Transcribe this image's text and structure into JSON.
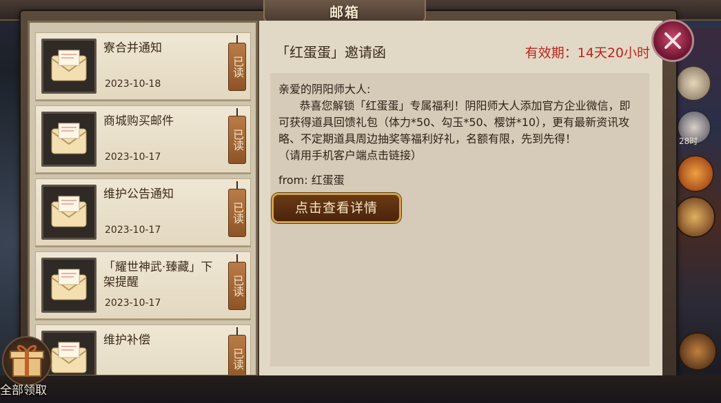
{
  "window": {
    "title": "邮箱"
  },
  "mail_list": [
    {
      "title": "寮合并通知",
      "date": "2023-10-18",
      "status": "已读"
    },
    {
      "title": "商城购买邮件",
      "date": "2023-10-17",
      "status": "已读"
    },
    {
      "title": "维护公告通知",
      "date": "2023-10-17",
      "status": "已读"
    },
    {
      "title": "「耀世神武·臻藏」下架提醒",
      "date": "2023-10-17",
      "status": "已读"
    },
    {
      "title": "维护补偿",
      "date": "",
      "status": "已读"
    }
  ],
  "detail": {
    "heading": "「红蛋蛋」邀请函",
    "validity": "有效期：14天20小时",
    "greeting": "亲爱的阴阳师大人:",
    "body": "      恭喜您解锁「红蛋蛋」专属福利！阴阳师大人添加官方企业微信，即可获得道具回馈礼包（体力*50、勾玉*50、樱饼*10），更有最新资讯攻略、不定期道具周边抽奖等福利好礼，名额有限，先到先得！\n（请用手机客户端点击链接）",
    "from": "from: 红蛋蛋",
    "button_label": "点击查看详情"
  },
  "side": {
    "timer": "28时"
  },
  "claim_all": {
    "label": "全部领取"
  },
  "colors": {
    "validity": "#b9261e",
    "button_border": "#d3a24a",
    "close_button": "#d04a6c"
  }
}
